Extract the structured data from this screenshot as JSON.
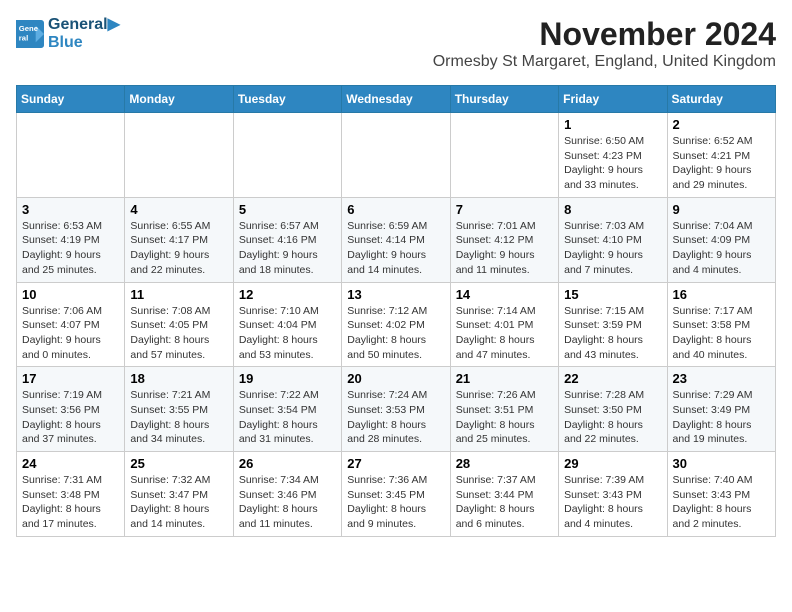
{
  "header": {
    "logo_line1": "General",
    "logo_line2": "Blue",
    "month_title": "November 2024",
    "subtitle": "Ormesby St Margaret, England, United Kingdom"
  },
  "weekdays": [
    "Sunday",
    "Monday",
    "Tuesday",
    "Wednesday",
    "Thursday",
    "Friday",
    "Saturday"
  ],
  "weeks": [
    [
      {
        "day": "",
        "info": ""
      },
      {
        "day": "",
        "info": ""
      },
      {
        "day": "",
        "info": ""
      },
      {
        "day": "",
        "info": ""
      },
      {
        "day": "",
        "info": ""
      },
      {
        "day": "1",
        "info": "Sunrise: 6:50 AM\nSunset: 4:23 PM\nDaylight: 9 hours\nand 33 minutes."
      },
      {
        "day": "2",
        "info": "Sunrise: 6:52 AM\nSunset: 4:21 PM\nDaylight: 9 hours\nand 29 minutes."
      }
    ],
    [
      {
        "day": "3",
        "info": "Sunrise: 6:53 AM\nSunset: 4:19 PM\nDaylight: 9 hours\nand 25 minutes."
      },
      {
        "day": "4",
        "info": "Sunrise: 6:55 AM\nSunset: 4:17 PM\nDaylight: 9 hours\nand 22 minutes."
      },
      {
        "day": "5",
        "info": "Sunrise: 6:57 AM\nSunset: 4:16 PM\nDaylight: 9 hours\nand 18 minutes."
      },
      {
        "day": "6",
        "info": "Sunrise: 6:59 AM\nSunset: 4:14 PM\nDaylight: 9 hours\nand 14 minutes."
      },
      {
        "day": "7",
        "info": "Sunrise: 7:01 AM\nSunset: 4:12 PM\nDaylight: 9 hours\nand 11 minutes."
      },
      {
        "day": "8",
        "info": "Sunrise: 7:03 AM\nSunset: 4:10 PM\nDaylight: 9 hours\nand 7 minutes."
      },
      {
        "day": "9",
        "info": "Sunrise: 7:04 AM\nSunset: 4:09 PM\nDaylight: 9 hours\nand 4 minutes."
      }
    ],
    [
      {
        "day": "10",
        "info": "Sunrise: 7:06 AM\nSunset: 4:07 PM\nDaylight: 9 hours\nand 0 minutes."
      },
      {
        "day": "11",
        "info": "Sunrise: 7:08 AM\nSunset: 4:05 PM\nDaylight: 8 hours\nand 57 minutes."
      },
      {
        "day": "12",
        "info": "Sunrise: 7:10 AM\nSunset: 4:04 PM\nDaylight: 8 hours\nand 53 minutes."
      },
      {
        "day": "13",
        "info": "Sunrise: 7:12 AM\nSunset: 4:02 PM\nDaylight: 8 hours\nand 50 minutes."
      },
      {
        "day": "14",
        "info": "Sunrise: 7:14 AM\nSunset: 4:01 PM\nDaylight: 8 hours\nand 47 minutes."
      },
      {
        "day": "15",
        "info": "Sunrise: 7:15 AM\nSunset: 3:59 PM\nDaylight: 8 hours\nand 43 minutes."
      },
      {
        "day": "16",
        "info": "Sunrise: 7:17 AM\nSunset: 3:58 PM\nDaylight: 8 hours\nand 40 minutes."
      }
    ],
    [
      {
        "day": "17",
        "info": "Sunrise: 7:19 AM\nSunset: 3:56 PM\nDaylight: 8 hours\nand 37 minutes."
      },
      {
        "day": "18",
        "info": "Sunrise: 7:21 AM\nSunset: 3:55 PM\nDaylight: 8 hours\nand 34 minutes."
      },
      {
        "day": "19",
        "info": "Sunrise: 7:22 AM\nSunset: 3:54 PM\nDaylight: 8 hours\nand 31 minutes."
      },
      {
        "day": "20",
        "info": "Sunrise: 7:24 AM\nSunset: 3:53 PM\nDaylight: 8 hours\nand 28 minutes."
      },
      {
        "day": "21",
        "info": "Sunrise: 7:26 AM\nSunset: 3:51 PM\nDaylight: 8 hours\nand 25 minutes."
      },
      {
        "day": "22",
        "info": "Sunrise: 7:28 AM\nSunset: 3:50 PM\nDaylight: 8 hours\nand 22 minutes."
      },
      {
        "day": "23",
        "info": "Sunrise: 7:29 AM\nSunset: 3:49 PM\nDaylight: 8 hours\nand 19 minutes."
      }
    ],
    [
      {
        "day": "24",
        "info": "Sunrise: 7:31 AM\nSunset: 3:48 PM\nDaylight: 8 hours\nand 17 minutes."
      },
      {
        "day": "25",
        "info": "Sunrise: 7:32 AM\nSunset: 3:47 PM\nDaylight: 8 hours\nand 14 minutes."
      },
      {
        "day": "26",
        "info": "Sunrise: 7:34 AM\nSunset: 3:46 PM\nDaylight: 8 hours\nand 11 minutes."
      },
      {
        "day": "27",
        "info": "Sunrise: 7:36 AM\nSunset: 3:45 PM\nDaylight: 8 hours\nand 9 minutes."
      },
      {
        "day": "28",
        "info": "Sunrise: 7:37 AM\nSunset: 3:44 PM\nDaylight: 8 hours\nand 6 minutes."
      },
      {
        "day": "29",
        "info": "Sunrise: 7:39 AM\nSunset: 3:43 PM\nDaylight: 8 hours\nand 4 minutes."
      },
      {
        "day": "30",
        "info": "Sunrise: 7:40 AM\nSunset: 3:43 PM\nDaylight: 8 hours\nand 2 minutes."
      }
    ]
  ]
}
